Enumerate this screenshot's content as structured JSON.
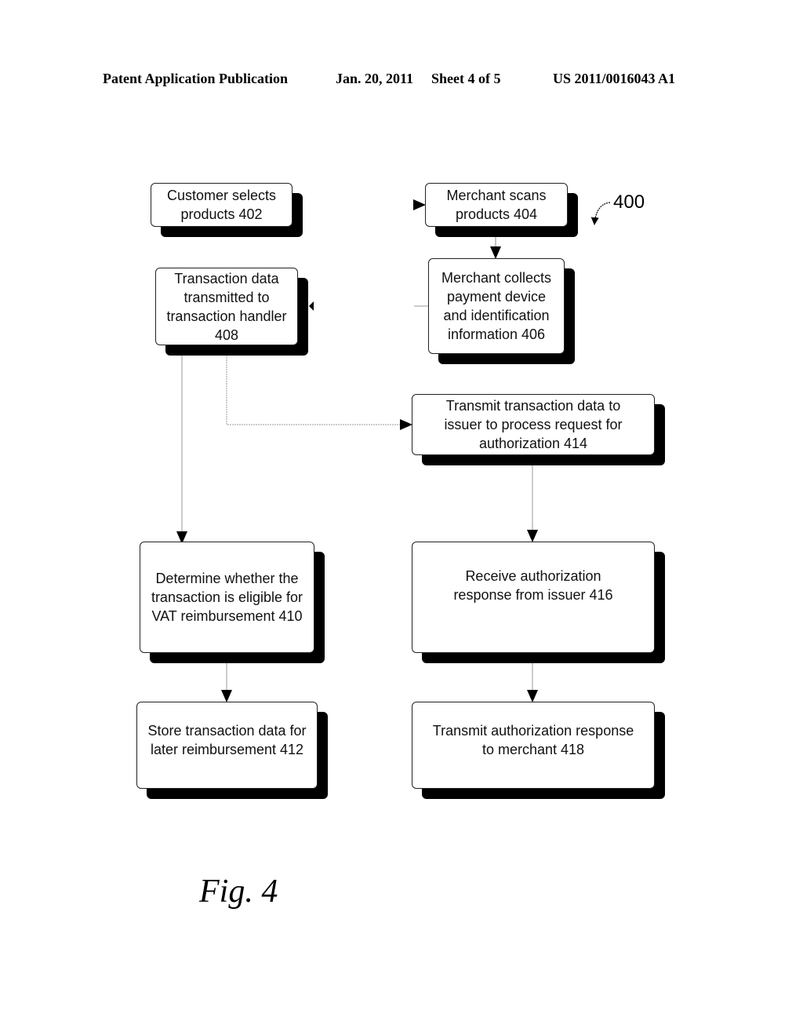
{
  "header": {
    "publication": "Patent Application Publication",
    "date": "Jan. 20, 2011",
    "sheet": "Sheet 4 of 5",
    "patent_number": "US 2011/0016043 A1"
  },
  "diagram": {
    "reference_number": "400",
    "figure_label": "Fig. 4",
    "nodes": {
      "n402": "Customer selects\nproducts  402",
      "n404": "Merchant scans\nproducts  404",
      "n406": "Merchant collects\npayment device\nand identification\ninformation  406",
      "n408": "Transaction data\ntransmitted to\ntransaction handler\n408",
      "n410": "Determine whether the\ntransaction is eligible for\nVAT reimbursement 410",
      "n412": "Store transaction data for\nlater reimbursement  412",
      "n414": "Transmit transaction data to\nissuer to process request for\nauthorization 414",
      "n416": "Receive authorization\nresponse from issuer 416",
      "n418": "Transmit authorization response\nto merchant 418"
    },
    "edges": [
      {
        "from": "402",
        "to": "404"
      },
      {
        "from": "404",
        "to": "406"
      },
      {
        "from": "406",
        "to": "408"
      },
      {
        "from": "408",
        "to": "410"
      },
      {
        "from": "408",
        "to": "414"
      },
      {
        "from": "410",
        "to": "412"
      },
      {
        "from": "414",
        "to": "416"
      },
      {
        "from": "416",
        "to": "418"
      }
    ]
  }
}
